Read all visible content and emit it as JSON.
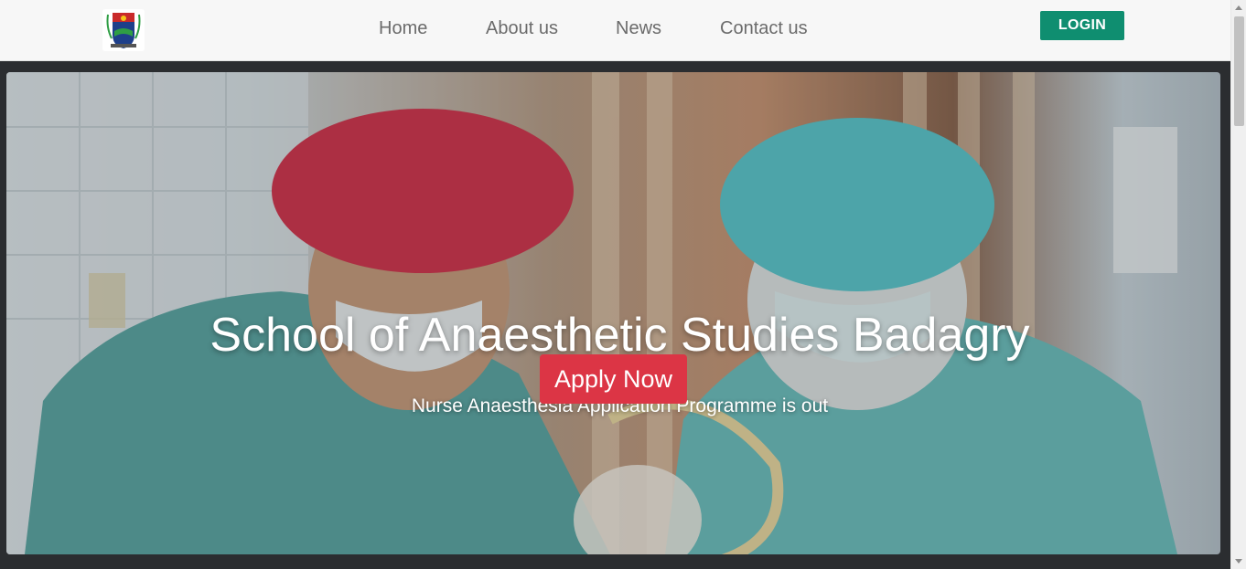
{
  "nav": {
    "links": [
      {
        "label": "Home"
      },
      {
        "label": "About us"
      },
      {
        "label": "News"
      },
      {
        "label": "Contact us"
      }
    ],
    "login_label": "LOGIN"
  },
  "hero": {
    "title": "School of Anaesthetic Studies Badagry",
    "subtitle": "Nurse Anaesthesia Application Programme is out",
    "apply_label": "Apply Now"
  },
  "colors": {
    "login_button": "#0f8e70",
    "apply_button": "#dc3545",
    "dark_band": "#2b2d30",
    "nav_text": "#6b6b6b"
  },
  "icons": {
    "logo": "crest-logo-icon"
  }
}
